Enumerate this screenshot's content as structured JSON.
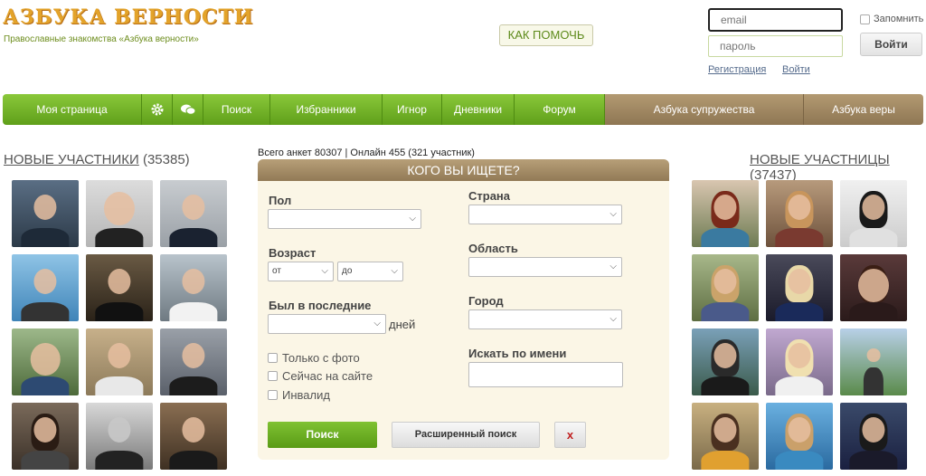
{
  "header": {
    "logo": "АЗБУКА ВЕРНОСТИ",
    "tagline": "Православные знакомства «Азбука верности»",
    "help_button": "КАК ПОМОЧЬ",
    "email_placeholder": "email",
    "password_placeholder": "пароль",
    "remember_label": "Запомнить",
    "login_button": "Войти",
    "register_link": "Регистрация",
    "enter_link": "Войти"
  },
  "nav": {
    "my_page": "Моя страница",
    "settings_icon": "gear-icon",
    "messages_icon": "chat-bubbles-icon",
    "search": "Поиск",
    "favorites": "Избранники",
    "ignore": "Игнор",
    "diaries": "Дневники",
    "forum": "Форум",
    "marriage": "Азбука супружества",
    "faith": "Азбука веры"
  },
  "left_column": {
    "title": "НОВЫЕ УЧАСТНИКИ",
    "count": "(35385)"
  },
  "right_column": {
    "title": "НОВЫЕ УЧАСТНИЦЫ",
    "count": "(37437)"
  },
  "stats": "Всего анкет 80307 | Онлайн 455 (321 участник)",
  "search": {
    "title": "КОГО ВЫ ИЩЕТЕ?",
    "gender_label": "Пол",
    "age_label": "Возраст",
    "age_from": "от",
    "age_to": "до",
    "last_seen_label": "Был в последние",
    "days_unit": "дней",
    "only_photo": "Только с фото",
    "online_now": "Сейчас на сайте",
    "disabled": "Инвалид",
    "country_label": "Страна",
    "region_label": "Область",
    "city_label": "Город",
    "name_label": "Искать по имени",
    "search_button": "Поиск",
    "advanced_button": "Расширенный поиск",
    "reset_button": "x"
  },
  "colors": {
    "nav_green": "#6fb12a",
    "nav_brown": "#a08a64",
    "logo": "#e3a32a",
    "panel_bg": "#fbf6e6"
  }
}
